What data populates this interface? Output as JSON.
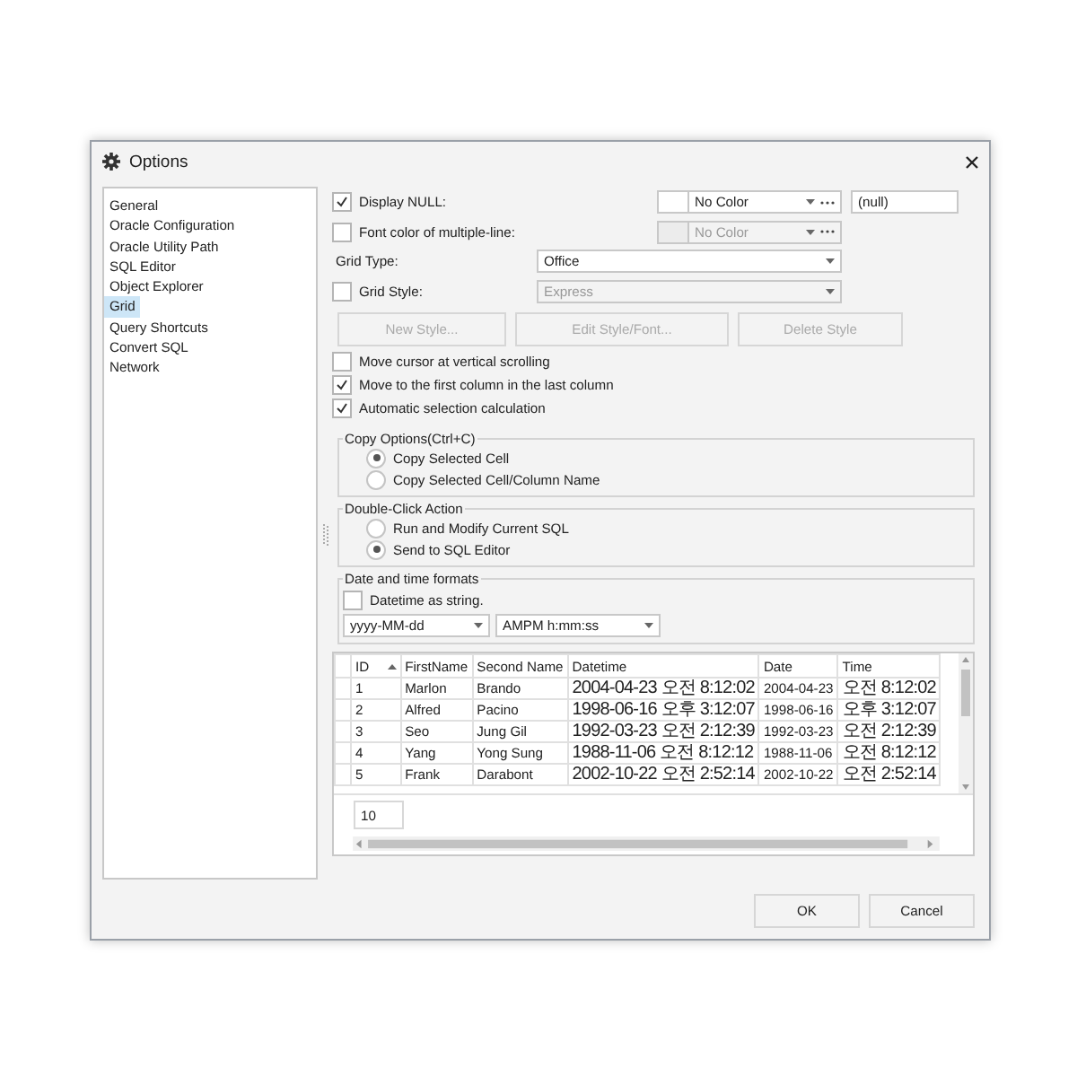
{
  "window": {
    "title": "Options"
  },
  "sidebar": {
    "items": [
      {
        "label": "General",
        "selected": false
      },
      {
        "label": "Oracle Configuration",
        "selected": false
      },
      {
        "label": "Oracle Utility Path",
        "selected": false
      },
      {
        "label": "SQL Editor",
        "selected": false
      },
      {
        "label": "Object Explorer",
        "selected": false
      },
      {
        "label": "Grid",
        "selected": true
      },
      {
        "label": "Query Shortcuts",
        "selected": false
      },
      {
        "label": "Convert SQL",
        "selected": false
      },
      {
        "label": "Network",
        "selected": false
      }
    ]
  },
  "display_null": {
    "label": "Display NULL:",
    "checked": true,
    "color_choice": "No Color",
    "disabled": false,
    "text": "(null)"
  },
  "font_color_multiline": {
    "label": "Font color of multiple-line:",
    "checked": false,
    "color_choice": "No Color",
    "disabled": true
  },
  "grid_type": {
    "label": "Grid Type:",
    "value": "Office",
    "disabled": false
  },
  "grid_style": {
    "label": "Grid Style:",
    "checked": false,
    "value": "Express",
    "disabled": true
  },
  "style_buttons": [
    {
      "label": "New Style...",
      "disabled": true
    },
    {
      "label": "Edit Style/Font...",
      "disabled": true
    },
    {
      "label": "Delete Style",
      "disabled": true
    }
  ],
  "options": [
    {
      "label": "Move cursor at vertical scrolling",
      "checked": false
    },
    {
      "label": "Move to the first column in the last column",
      "checked": true
    },
    {
      "label": "Automatic selection calculation",
      "checked": true
    }
  ],
  "copy_options": {
    "title": "Copy Options(Ctrl+C)",
    "choices": [
      {
        "label": "Copy Selected Cell",
        "selected": true
      },
      {
        "label": "Copy Selected Cell/Column Name",
        "selected": false
      }
    ]
  },
  "double_click_action": {
    "title": "Double-Click Action",
    "choices": [
      {
        "label": "Run and Modify Current SQL",
        "selected": false
      },
      {
        "label": "Send to SQL Editor",
        "selected": true
      }
    ]
  },
  "date_time_formats": {
    "title": "Date and time formats",
    "datetime_as_string": {
      "label": "Datetime as string.",
      "checked": false
    },
    "date_format": "yyyy-MM-dd",
    "time_format": "AMPM h:mm:ss"
  },
  "preview_grid": {
    "columns": [
      {
        "label": "ID",
        "sorted": true
      },
      {
        "label": "FirstName",
        "sorted": false
      },
      {
        "label": "Second Name",
        "sorted": false
      },
      {
        "label": "Datetime",
        "sorted": false
      },
      {
        "label": "Date",
        "sorted": false
      },
      {
        "label": "Time",
        "sorted": false
      }
    ],
    "rows": [
      [
        "1",
        "Marlon",
        "Brando",
        "2004-04-23 오전 8:12:02",
        "2004-04-23",
        "오전 8:12:02"
      ],
      [
        "2",
        "Alfred",
        "Pacino",
        "1998-06-16 오후 3:12:07",
        "1998-06-16",
        "오후 3:12:07"
      ],
      [
        "3",
        "Seo",
        "Jung Gil",
        "1992-03-23 오전 2:12:39",
        "1992-03-23",
        "오전 2:12:39"
      ],
      [
        "4",
        "Yang",
        "Yong Sung",
        "1988-11-06 오전 8:12:12",
        "1988-11-06",
        "오전 8:12:12"
      ],
      [
        "5",
        "Frank",
        "Darabont",
        "2002-10-22 오전 2:52:14",
        "2002-10-22",
        "오전 2:52:14"
      ]
    ],
    "footer": "10"
  },
  "buttons": [
    {
      "label": "OK"
    },
    {
      "label": "Cancel"
    }
  ]
}
